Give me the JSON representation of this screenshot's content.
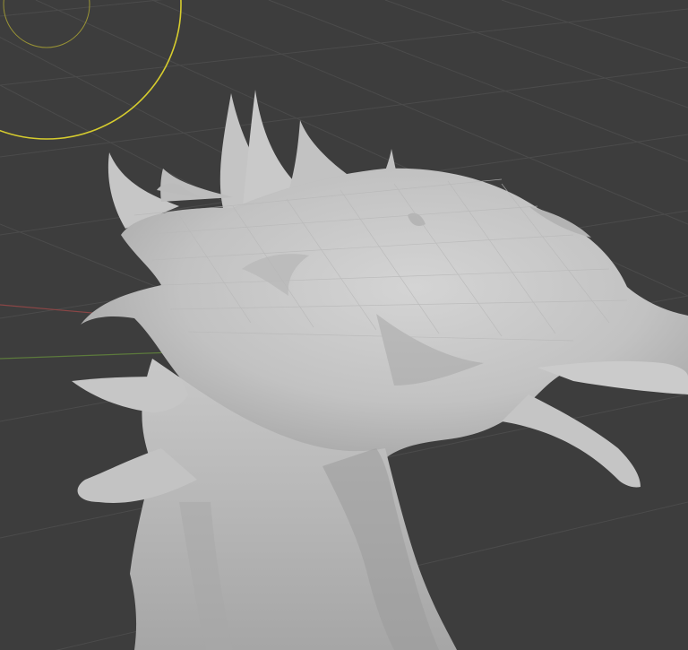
{
  "viewport": {
    "background": "#3d3d3d",
    "grid_color": "#4a4a4a",
    "x_axis_color": "#8a4646",
    "y_axis_color": "#5c7a3c",
    "brush_color": "#d6cc2e",
    "mesh_color": "#c7c7c7",
    "mesh_shadow_color": "#9a9a9a",
    "mesh_highlight_color": "#d8d8d8"
  },
  "scene": {
    "object": "sculpt-mesh",
    "mode_hint": "sculpt",
    "brush_cursor": "brush-radius-circle",
    "shading": "solid"
  }
}
